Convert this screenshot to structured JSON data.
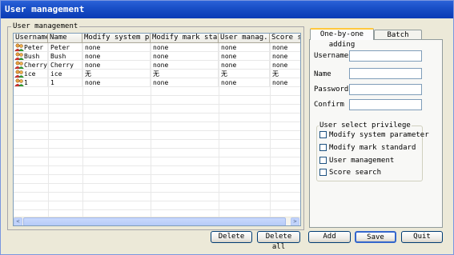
{
  "window": {
    "title": "User management"
  },
  "group": {
    "label": "User management"
  },
  "table": {
    "columns": [
      "Username",
      "Name",
      "Modify system p...",
      "Modify mark sta...",
      "User manag...",
      "Score sea"
    ],
    "rows": [
      [
        "Peter",
        "Peter",
        "none",
        "none",
        "none",
        "none"
      ],
      [
        "Bush",
        "Bush",
        "none",
        "none",
        "none",
        "none"
      ],
      [
        "Cherry",
        "Cherry",
        "none",
        "none",
        "none",
        "none"
      ],
      [
        "ice",
        "ice",
        "无",
        "无",
        "无",
        "无"
      ],
      [
        "1",
        "1",
        "none",
        "none",
        "none",
        "none"
      ]
    ]
  },
  "buttons": {
    "delete": "Delete",
    "delete_all": "Delete all",
    "add": "Add",
    "save": "Save",
    "quit": "Quit"
  },
  "tabs": {
    "one_by_one": "One-by-one adding",
    "batch": "Batch adding"
  },
  "form": {
    "username_label": "Username",
    "name_label": "Name",
    "password_label": "Password",
    "confirm_label": "Confirm",
    "username_value": "",
    "name_value": "",
    "password_value": "",
    "confirm_value": ""
  },
  "privileges": {
    "label": "User select privilege",
    "items": [
      "Modify system parameter",
      "Modify mark standard",
      "User management",
      "Score search"
    ]
  },
  "scrollbar": {
    "left_arrow": "<",
    "right_arrow": ">"
  },
  "icons": {
    "user": "user-group-icon"
  }
}
